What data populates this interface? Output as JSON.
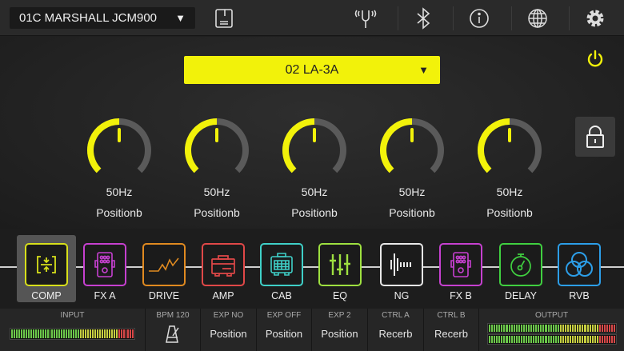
{
  "topbar": {
    "preset": "01C MARSHALL JCM900",
    "dropdown_arrow": "▼",
    "icons": [
      "save-icon",
      "tuner-icon",
      "bluetooth-icon",
      "info-icon",
      "globe-icon",
      "gear-icon"
    ]
  },
  "module": {
    "selected": "02 LA-3A",
    "arrow": "▼",
    "power_color": "#f2f20a"
  },
  "knobs": [
    {
      "value": "50Hz",
      "label": "Positionb",
      "fraction": 0.5
    },
    {
      "value": "50Hz",
      "label": "Positionb",
      "fraction": 0.5
    },
    {
      "value": "50Hz",
      "label": "Positionb",
      "fraction": 0.5
    },
    {
      "value": "50Hz",
      "label": "Positionb",
      "fraction": 0.5
    },
    {
      "value": "50Hz",
      "label": "Positionb",
      "fraction": 0.5
    }
  ],
  "chain": [
    {
      "label": "COMP",
      "color": "#d8e01a",
      "selected": true
    },
    {
      "label": "FX A",
      "color": "#c640d0"
    },
    {
      "label": "DRIVE",
      "color": "#e08a20"
    },
    {
      "label": "AMP",
      "color": "#e04848"
    },
    {
      "label": "CAB",
      "color": "#3fd0c8"
    },
    {
      "label": "EQ",
      "color": "#9ee040"
    },
    {
      "label": "NG",
      "color": "#e8e8e8"
    },
    {
      "label": "FX B",
      "color": "#c640d0"
    },
    {
      "label": "DELAY",
      "color": "#40d040"
    },
    {
      "label": "RVB",
      "color": "#2c9ee8"
    }
  ],
  "bottom": {
    "input": "INPUT",
    "bpm": "BPM 120",
    "exp_no": {
      "h": "EXP NO",
      "v": "Position"
    },
    "exp_off": {
      "h": "EXP OFF",
      "v": "Position"
    },
    "exp2": {
      "h": "EXP 2",
      "v": "Position"
    },
    "ctrl_a": {
      "h": "CTRL A",
      "v": "Recerb"
    },
    "ctrl_b": {
      "h": "CTRL B",
      "v": "Recerb"
    },
    "output": "OUTPUT"
  }
}
